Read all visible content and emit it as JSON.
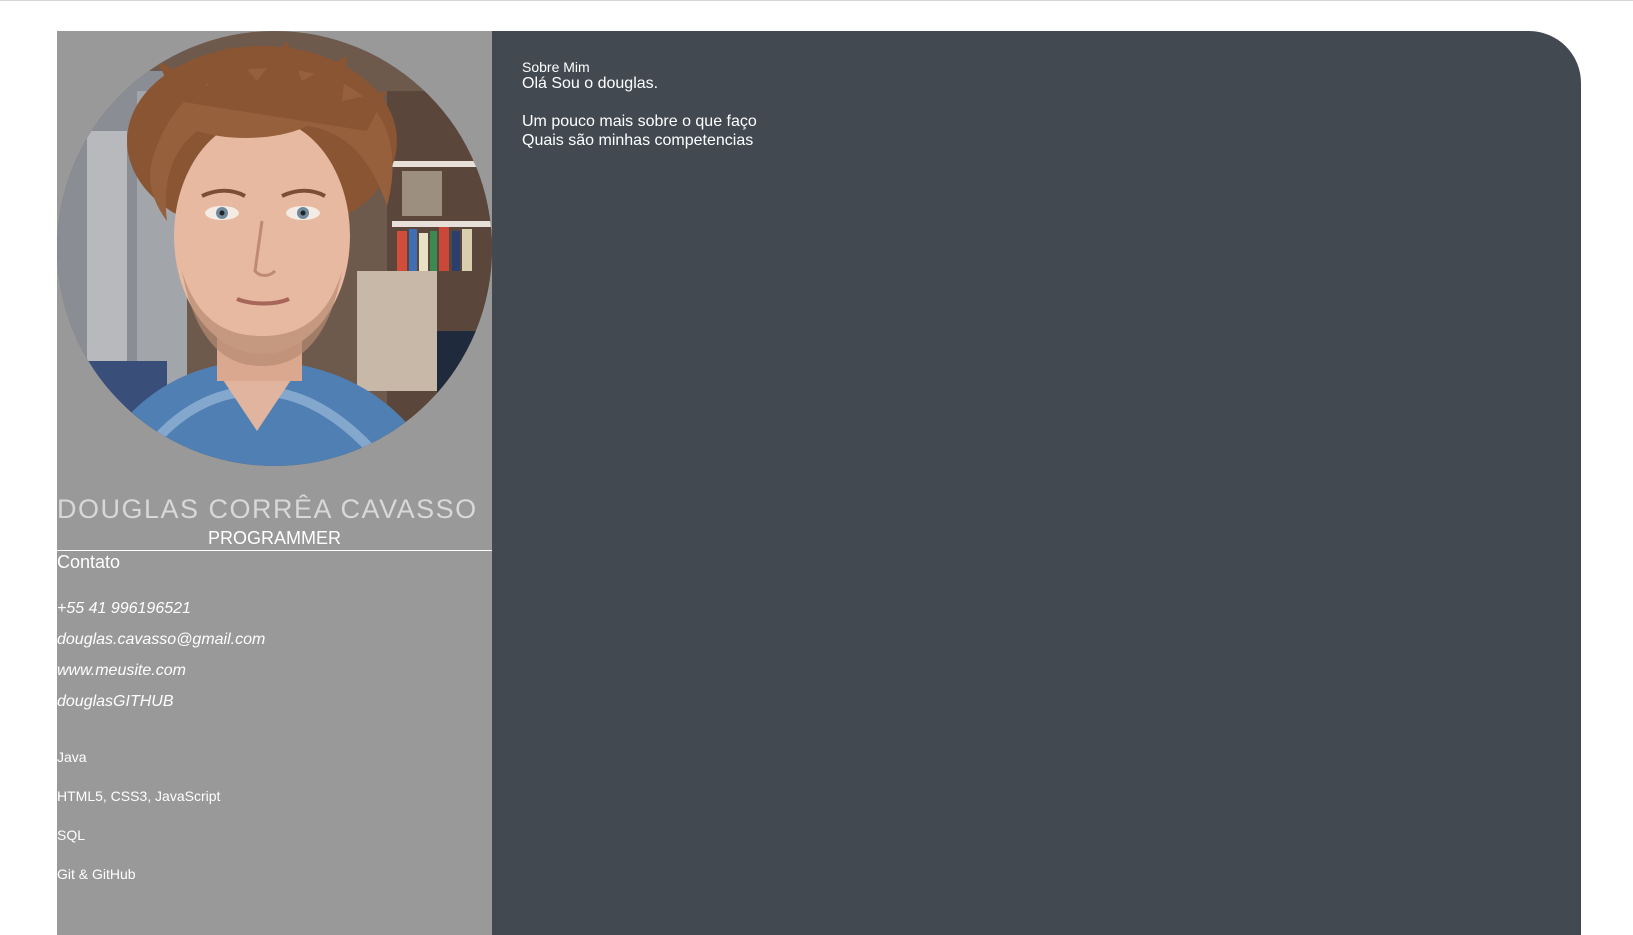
{
  "profile": {
    "name": "DOUGLAS CORRÊA CAVASSO",
    "role": "PROGRAMMER",
    "photo_icon": "profile-photo"
  },
  "contact": {
    "heading": "Contato",
    "items": [
      "+55 41 996196521",
      "douglas.cavasso@gmail.com",
      "www.meusite.com",
      "douglasGITHUB"
    ]
  },
  "skills": {
    "items": [
      "Java",
      "HTML5, CSS3, JavaScript",
      "SQL",
      "Git & GitHub"
    ]
  },
  "about": {
    "heading": "Sobre Mim",
    "greeting": "Olá Sou o douglas.",
    "more": "Um pouco mais sobre o que faço",
    "skills_title": "Quais são minhas competencias"
  },
  "colors": {
    "sidebar_bg": "#999999",
    "main_bg": "#424950",
    "text": "#ffffff"
  }
}
